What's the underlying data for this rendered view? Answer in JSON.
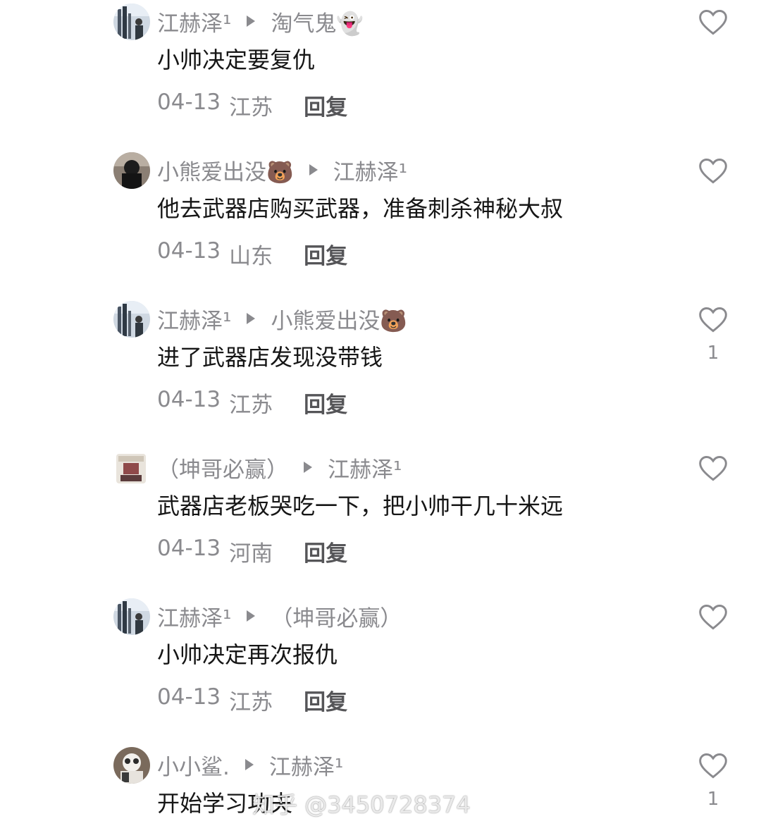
{
  "comments": [
    {
      "user": "江赫泽¹",
      "reply_to": "淘气鬼👻",
      "text": "小帅决定要复仇",
      "date": "04-13",
      "location": "江苏",
      "reply_label": "回复",
      "likes": "",
      "avatar": "city-photo-avatar"
    },
    {
      "user": "小熊爱出没🐻",
      "reply_to": "江赫泽¹",
      "text": "他去武器店购买武器，准备刺杀神秘大叔",
      "date": "04-13",
      "location": "山东",
      "reply_label": "回复",
      "likes": "",
      "avatar": "dark-figure-avatar"
    },
    {
      "user": "江赫泽¹",
      "reply_to": "小熊爱出没🐻",
      "text": "进了武器店发现没带钱",
      "date": "04-13",
      "location": "江苏",
      "reply_label": "回复",
      "likes": "1",
      "avatar": "city-photo-avatar"
    },
    {
      "user": "（坤哥必赢）",
      "reply_to": "江赫泽¹",
      "text": "武器店老板哭吃一下，把小帅干几十米远",
      "date": "04-13",
      "location": "河南",
      "reply_label": "回复",
      "likes": "",
      "avatar": "meme-image-avatar"
    },
    {
      "user": "江赫泽¹",
      "reply_to": "（坤哥必赢）",
      "text": "小帅决定再次报仇",
      "date": "04-13",
      "location": "江苏",
      "reply_label": "回复",
      "likes": "",
      "avatar": "city-photo-avatar"
    },
    {
      "user": "小小鲨.",
      "reply_to": "江赫泽¹",
      "text": "开始学习功夫",
      "date": "",
      "location": "",
      "reply_label": "",
      "likes": "1",
      "avatar": "cat-photo-avatar"
    }
  ],
  "watermark": "知乎 @3450728374",
  "colors": {
    "name": "#8a8a8e",
    "text": "#161616",
    "reply": "#555558",
    "icon": "#8a8a8e"
  }
}
